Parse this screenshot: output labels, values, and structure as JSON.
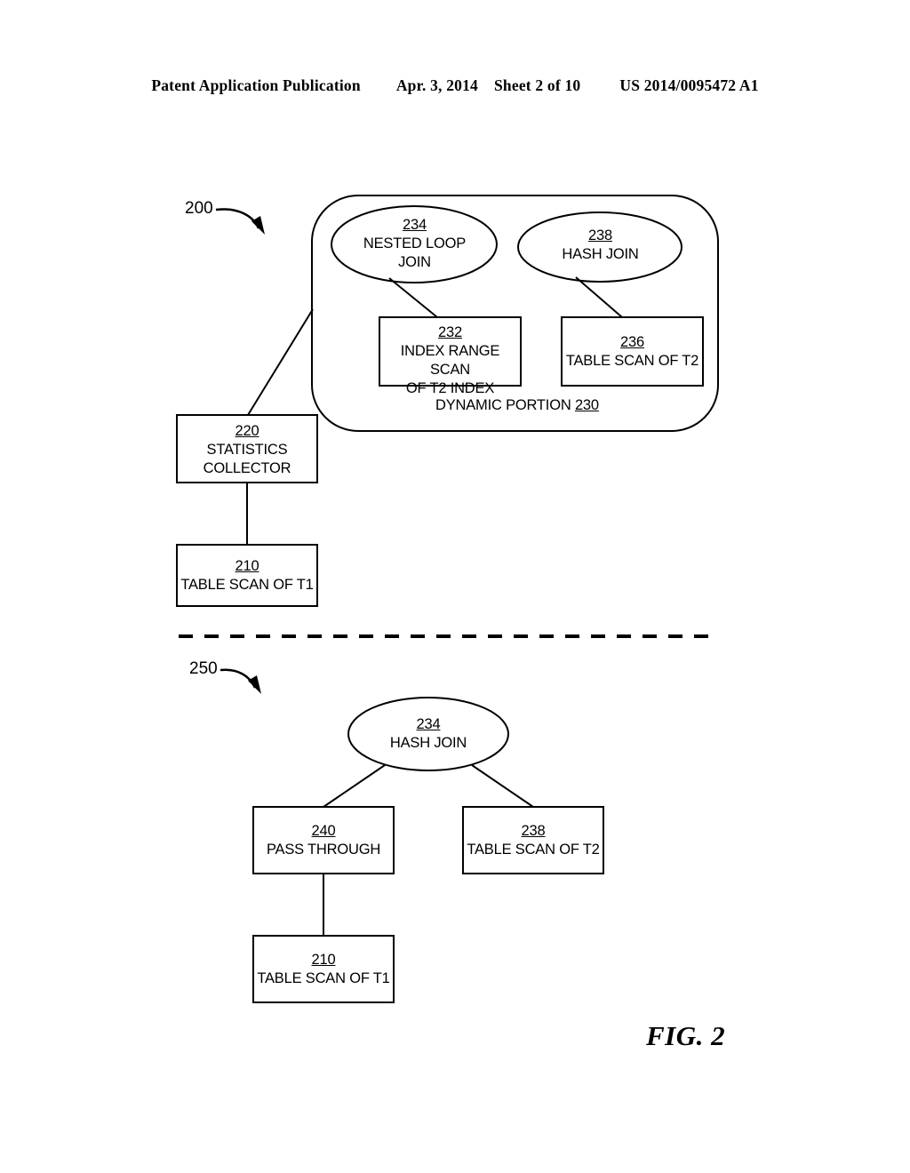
{
  "header": {
    "publication": "Patent Application Publication",
    "date": "Apr. 3, 2014",
    "sheet": "Sheet 2 of 10",
    "patent_number": "US 2014/0095472 A1"
  },
  "figure": {
    "caption": "FIG. 2",
    "diagram_refs": {
      "top_plan": "200",
      "bottom_plan": "250"
    },
    "container": {
      "label": "DYNAMIC PORTION",
      "ref": "230"
    }
  },
  "top_plan": {
    "nodes": [
      {
        "id": "nested-loop-join",
        "ref": "234",
        "line1": "NESTED LOOP",
        "line2": "JOIN",
        "shape": "ellipse"
      },
      {
        "id": "hash-join",
        "ref": "238",
        "line1": "HASH JOIN",
        "line2": "",
        "shape": "ellipse"
      },
      {
        "id": "index-range-scan",
        "ref": "232",
        "line1": "INDEX RANGE SCAN",
        "line2": "OF T2 INDEX",
        "shape": "box"
      },
      {
        "id": "table-scan-t2",
        "ref": "236",
        "line1": "TABLE SCAN OF T2",
        "line2": "",
        "shape": "box"
      },
      {
        "id": "statistics-collector",
        "ref": "220",
        "line1": "STATISTICS",
        "line2": "COLLECTOR",
        "shape": "box"
      },
      {
        "id": "table-scan-t1",
        "ref": "210",
        "line1": "TABLE SCAN OF T1",
        "line2": "",
        "shape": "box"
      }
    ]
  },
  "bottom_plan": {
    "nodes": [
      {
        "id": "hash-join-bottom",
        "ref": "234",
        "line1": "HASH JOIN",
        "line2": "",
        "shape": "ellipse"
      },
      {
        "id": "pass-through",
        "ref": "240",
        "line1": "PASS THROUGH",
        "line2": "",
        "shape": "box"
      },
      {
        "id": "table-scan-t2-bottom",
        "ref": "238",
        "line1": "TABLE SCAN OF T2",
        "line2": "",
        "shape": "box"
      },
      {
        "id": "table-scan-t1-bottom",
        "ref": "210",
        "line1": "TABLE SCAN OF T1",
        "line2": "",
        "shape": "box"
      }
    ]
  },
  "colors": {
    "ink": "#000000",
    "paper": "#ffffff"
  }
}
